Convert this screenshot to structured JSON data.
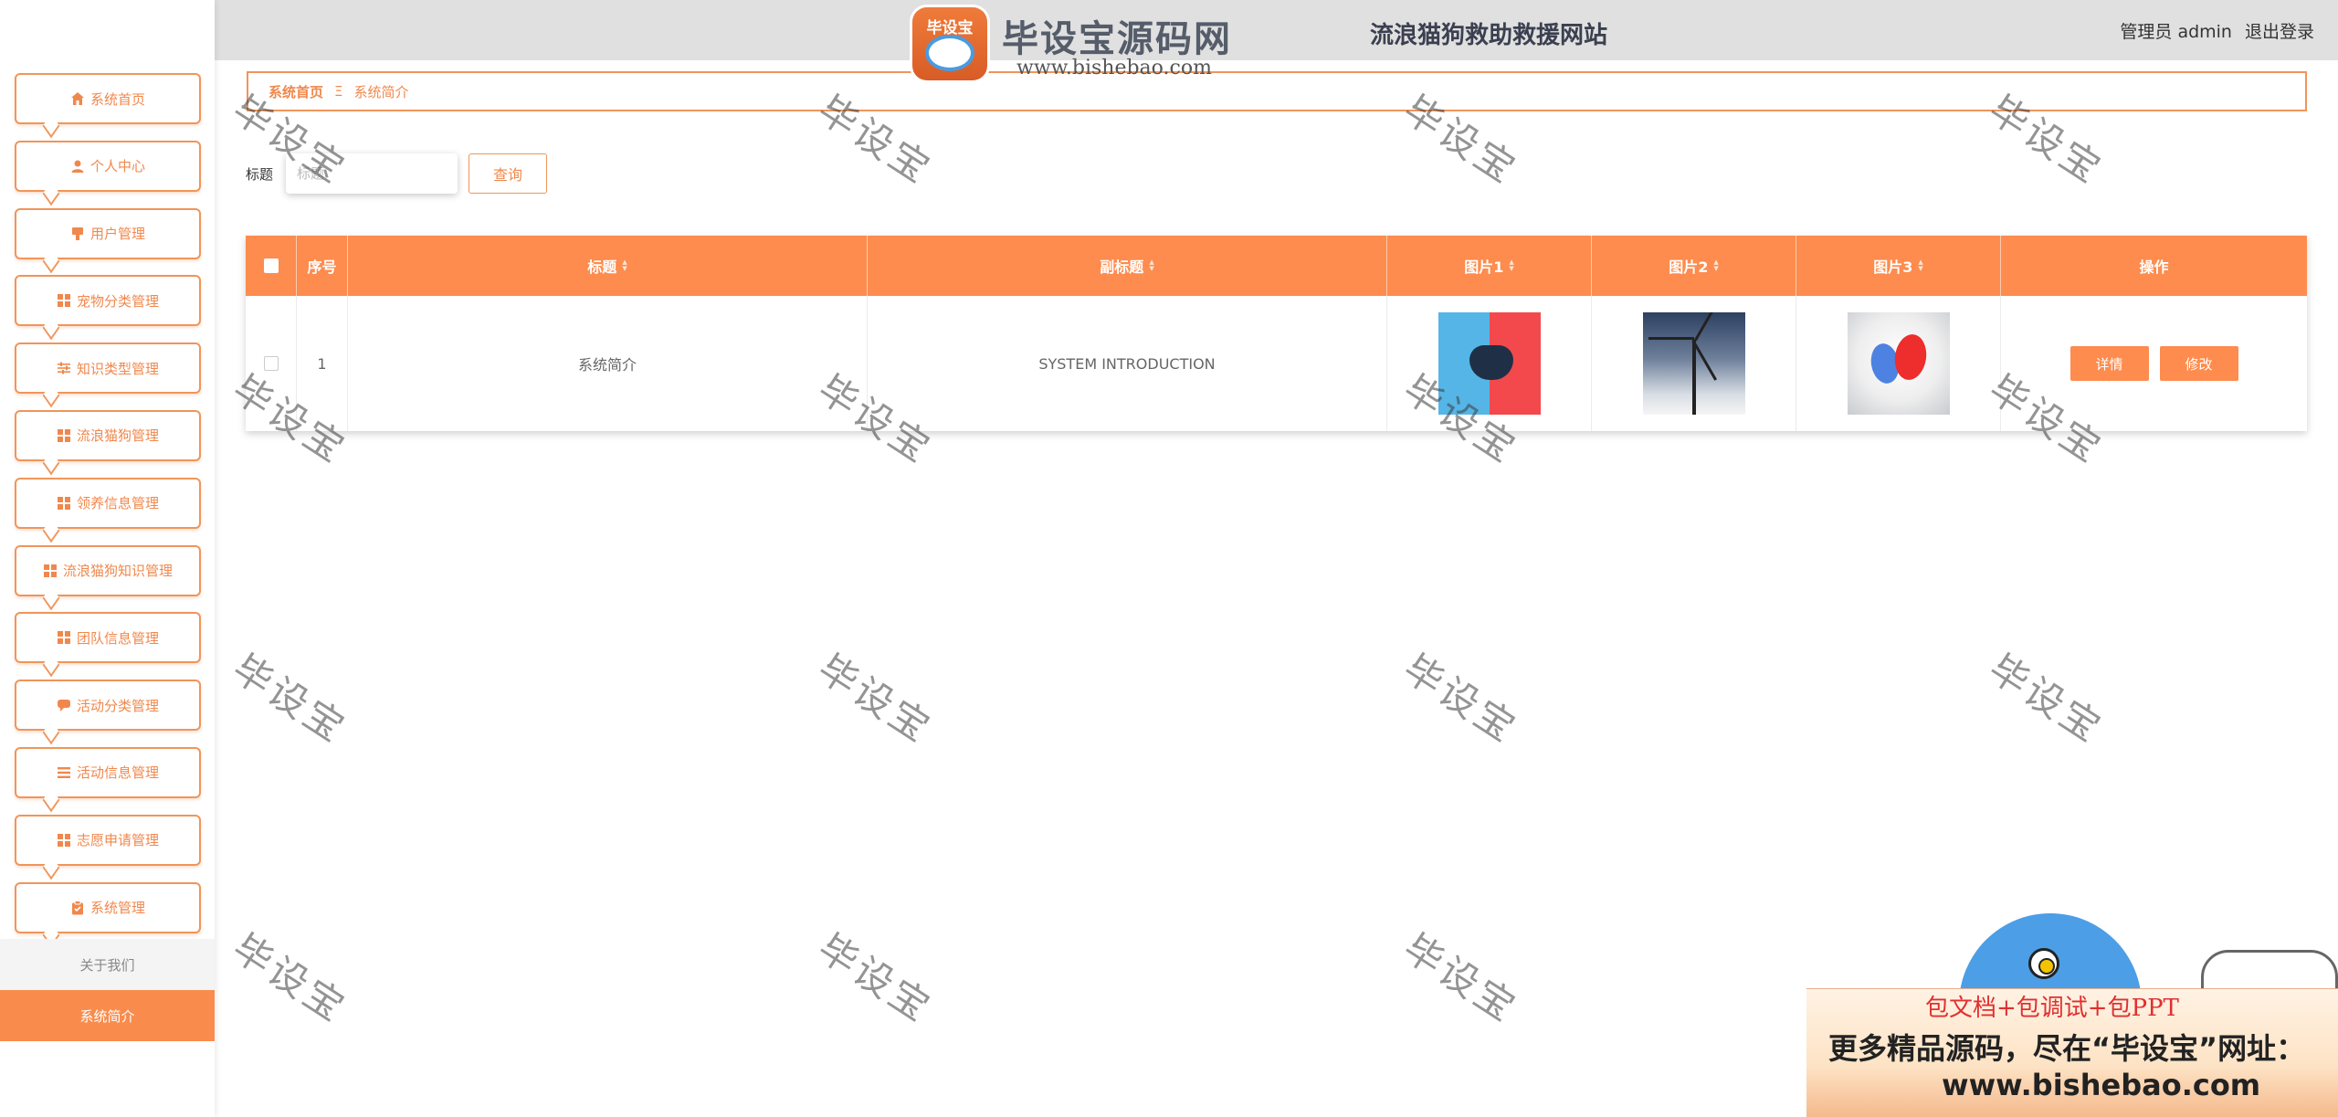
{
  "header": {
    "site_title": "流浪猫狗救助救援网站",
    "user_role": "管理员",
    "username": "admin",
    "logout_label": "退出登录"
  },
  "brand_watermark": {
    "logo_text": "毕设宝",
    "name": "毕设宝源码网",
    "url": "www.bishebao.com"
  },
  "sidebar": {
    "items": [
      {
        "label": "系统首页",
        "icon": "home-icon"
      },
      {
        "label": "个人中心",
        "icon": "user-icon"
      },
      {
        "label": "用户管理",
        "icon": "user-manage-icon"
      },
      {
        "label": "宠物分类管理",
        "icon": "grid-icon"
      },
      {
        "label": "知识类型管理",
        "icon": "sliders-icon"
      },
      {
        "label": "流浪猫狗管理",
        "icon": "grid-icon"
      },
      {
        "label": "领养信息管理",
        "icon": "grid-icon"
      },
      {
        "label": "流浪猫狗知识管理",
        "icon": "grid-icon"
      },
      {
        "label": "团队信息管理",
        "icon": "grid-icon"
      },
      {
        "label": "活动分类管理",
        "icon": "chat-icon"
      },
      {
        "label": "活动信息管理",
        "icon": "list-icon"
      },
      {
        "label": "志愿申请管理",
        "icon": "grid-icon"
      },
      {
        "label": "系统管理",
        "icon": "clipboard-icon"
      }
    ],
    "sub_items": [
      {
        "label": "关于我们"
      },
      {
        "label": "系统简介"
      }
    ]
  },
  "breadcrumb": {
    "home": "系统首页",
    "separator": "Ξ",
    "current": "系统简介"
  },
  "search": {
    "label": "标题",
    "placeholder": "标题",
    "button_label": "查询"
  },
  "table": {
    "headers": [
      "序号",
      "标题",
      "副标题",
      "图片1",
      "图片2",
      "图片3",
      "操作"
    ],
    "rows": [
      {
        "index": "1",
        "title": "系统简介",
        "subtitle": "SYSTEM INTRODUCTION",
        "image1": "gamepad-image",
        "image2": "wind-turbine-image",
        "image3": "balloons-image",
        "actions": [
          "详情",
          "修改"
        ]
      }
    ]
  },
  "watermark_text": "毕设宝",
  "ad_banner": {
    "line1": "包文档+包调试+包PPT",
    "line2": "更多精品源码，尽在“毕设宝”网址：",
    "line3": "www.bishebao.com"
  },
  "colors": {
    "accent": "#fd8c4e",
    "header_bg": "#e0e0e0",
    "active_menu_bg": "#f98c4d"
  }
}
